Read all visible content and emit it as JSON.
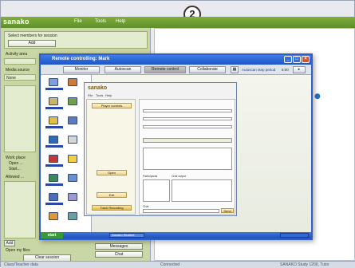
{
  "app": {
    "logo": "sanako",
    "menu": [
      "File",
      "Tools",
      "Help"
    ],
    "step_number": "2"
  },
  "left_panel": {
    "select_members_label": "Select members for session",
    "add_button": "Add",
    "activity_label": "Activity area",
    "media_label": "Media source",
    "media_value": "None",
    "work_label": "Work place",
    "options": [
      "Open ...",
      "Start..."
    ],
    "allowed_label": "Allowed ...",
    "bottom_add": "Add",
    "open_label": "Open my files",
    "clear_session": "Clear session",
    "messages": "Messages",
    "chat": "Chat"
  },
  "remote_window": {
    "title": "Remote controlling: Mark",
    "tabs": [
      "Monitor",
      "Autoscan",
      "Remote control",
      "Collaborate"
    ],
    "autoscan_label": "Autoscan step period",
    "autoscan_value": "5:00",
    "start_button": "start",
    "task_item": "Sanako Student"
  },
  "inner_app": {
    "logo": "sanako",
    "menu": [
      "File",
      "Tools",
      "Help"
    ],
    "player_controls": "Player controls",
    "play_button": "Open",
    "exit_button": "Exit",
    "recording_label": "Track Recording",
    "participants_label": "Participants",
    "chat_label": "Chat",
    "output_label": "Chat output",
    "send_button": "Send"
  },
  "status_bar": {
    "left": "Class/Teacher data",
    "middle": "Connected",
    "right": "SANAKO Study 1200, Tutor"
  },
  "colors": {
    "title_green": "#6e9e33",
    "remote_blue": "#2f5fcf",
    "panel_green": "#c9d6a5"
  }
}
